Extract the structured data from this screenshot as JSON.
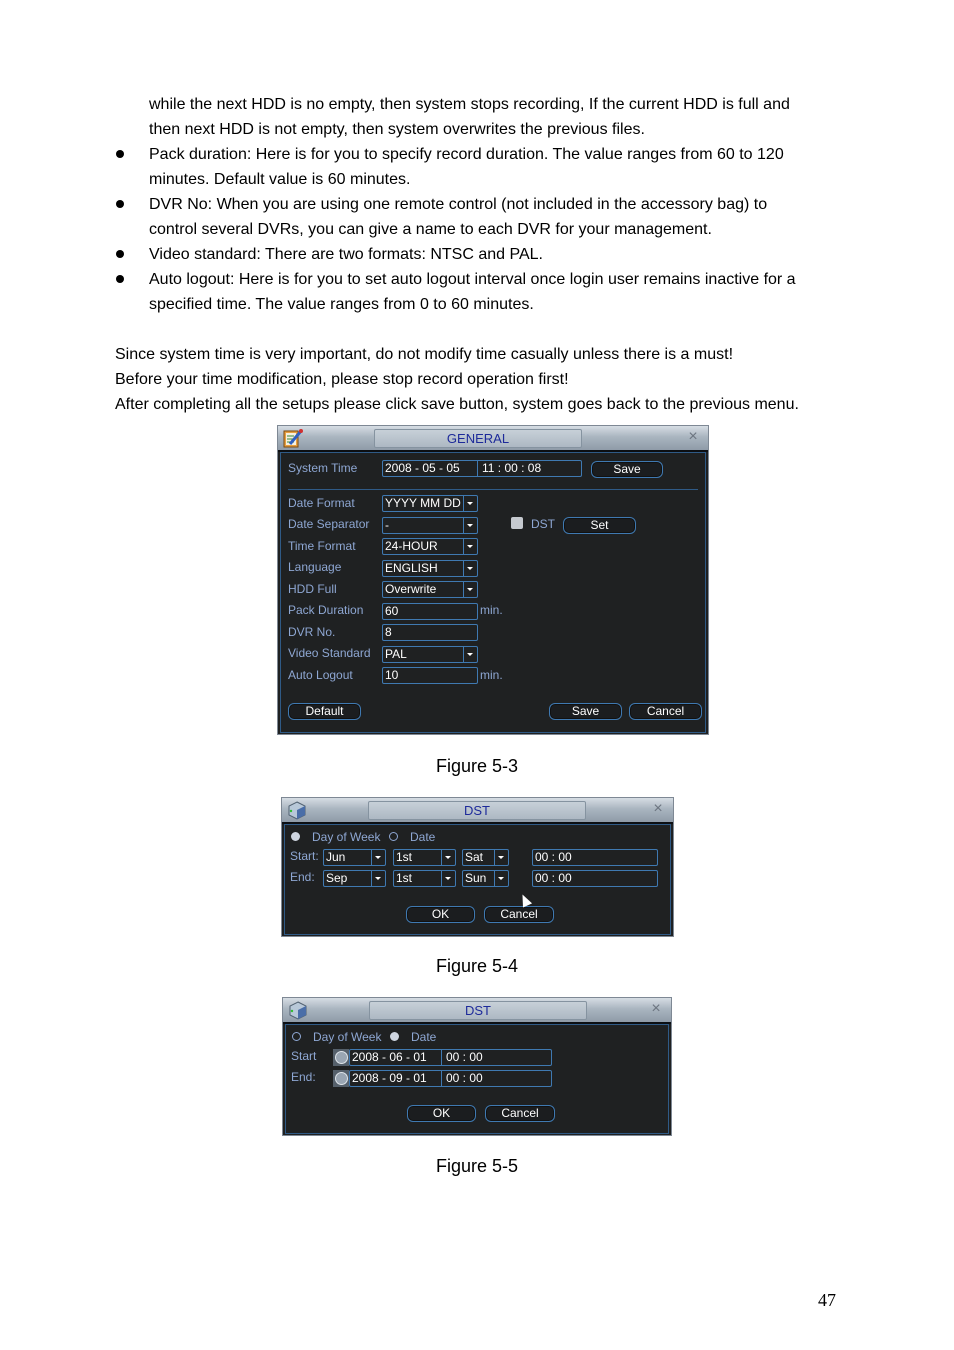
{
  "text": {
    "p1_line1": "while the next HDD is no empty, then system stops recording, If the current HDD is full and",
    "p1_line2": "then next HDD is not empty, then system overwrites the previous files.",
    "b1_line1": "Pack duration: Here is for you to specify record duration. The value ranges from 60 to 120",
    "b1_line2": "minutes. Default value is 60 minutes.",
    "b2_line1": "DVR No: When you are using one remote control (not included in the accessory bag) to",
    "b2_line2": "control several DVRs, you can give a name to each DVR for your management.",
    "b3_line1": "Video standard: There are two formats: NTSC and PAL.",
    "b4_line1": "Auto logout: Here is for you to set auto logout interval once login user remains inactive for a",
    "b4_line2": "specified time. The value ranges from 0 to 60 minutes.",
    "note1": "Since system time is very important, do not modify time casually unless there is a must!",
    "note2": "Before your time modification, please stop record operation first!",
    "note3": "After completing all the setups please click save button, system goes back to the previous menu."
  },
  "general": {
    "title": "GENERAL",
    "close_icon": "×",
    "system_time_label": "System Time",
    "system_date": "2008  - 05 - 05",
    "system_clock": "11 : 00 : 08",
    "save_top": "Save",
    "rows": [
      {
        "label": "Date Format",
        "value": "YYYY MM DD"
      },
      {
        "label": "Date Separator",
        "value": "-"
      },
      {
        "label": "Time Format",
        "value": "24-HOUR"
      },
      {
        "label": "Language",
        "value": "ENGLISH"
      },
      {
        "label": "HDD Full",
        "value": "Overwrite"
      },
      {
        "label": "Pack Duration",
        "value": "60",
        "unit": "min."
      },
      {
        "label": "DVR No.",
        "value": "8"
      },
      {
        "label": "Video Standard",
        "value": "PAL"
      },
      {
        "label": "Auto Logout",
        "value": "10",
        "unit": "min."
      }
    ],
    "dst_label": "DST",
    "dst_checked": false,
    "set_button": "Set",
    "default_button": "Default",
    "save_button": "Save",
    "cancel_button": "Cancel"
  },
  "dst_week": {
    "title": "DST",
    "close_icon": "×",
    "mode_day_of_week": "Day of Week",
    "mode_date": "Date",
    "selected_mode": "Day of Week",
    "start_label": "Start:",
    "end_label": "End:",
    "start": {
      "month": "Jun",
      "week": "1st",
      "day": "Sat",
      "time": "00   :  00"
    },
    "end": {
      "month": "Sep",
      "week": "1st",
      "day": "Sun",
      "time": "00   :  00"
    },
    "ok_button": "OK",
    "cancel_button": "Cancel"
  },
  "dst_date": {
    "title": "DST",
    "close_icon": "×",
    "mode_day_of_week": "Day of Week",
    "mode_date": "Date",
    "selected_mode": "Date",
    "start_label": "Start",
    "end_label": "End:",
    "start": {
      "date": "2008  - 06 - 01",
      "time": "00 :  00"
    },
    "end": {
      "date": "2008  - 09 - 01",
      "time": "00 :  00"
    },
    "ok_button": "OK",
    "cancel_button": "Cancel"
  },
  "captions": {
    "fig3": "Figure 5-3",
    "fig4": "Figure 5-4",
    "fig5": "Figure 5-5"
  },
  "page_number": "47"
}
